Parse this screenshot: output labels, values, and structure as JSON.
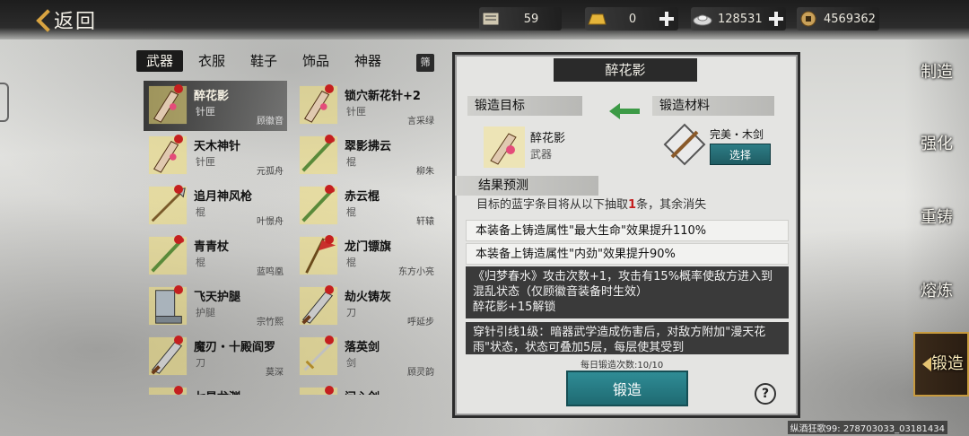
{
  "header": {
    "back_label": "返回",
    "resources": [
      {
        "icon": "ledger-icon",
        "value": "59",
        "plus": false
      },
      {
        "icon": "gold-bar-icon",
        "value": "0",
        "plus": true
      },
      {
        "icon": "silver-ingot-icon",
        "value": "128531",
        "plus": true
      },
      {
        "icon": "copper-coin-icon",
        "value": "4569362",
        "plus": false
      }
    ]
  },
  "tabs": [
    "武器",
    "衣服",
    "鞋子",
    "饰品",
    "神器"
  ],
  "active_tab": "武器",
  "filter_label": "筛",
  "items": [
    {
      "name": "醉花影",
      "type": "针匣",
      "owner": "顾徽音",
      "selected": true,
      "icon": "needle-box-icon"
    },
    {
      "name": "锁穴新花针+2",
      "type": "针匣",
      "owner": "言采绿",
      "selected": false,
      "icon": "needle-box-icon"
    },
    {
      "name": "天木神针",
      "type": "针匣",
      "owner": "元孤舟",
      "selected": false,
      "icon": "needle-box-icon"
    },
    {
      "name": "翠影拂云",
      "type": "棍",
      "owner": "柳朱",
      "selected": false,
      "icon": "staff-icon"
    },
    {
      "name": "追月神风枪",
      "type": "棍",
      "owner": "叶憬舟",
      "selected": false,
      "icon": "spear-icon"
    },
    {
      "name": "赤云棍",
      "type": "棍",
      "owner": "轩辕",
      "selected": false,
      "icon": "staff-icon"
    },
    {
      "name": "青青杖",
      "type": "棍",
      "owner": "蓝鸣凰",
      "selected": false,
      "icon": "staff-icon"
    },
    {
      "name": "龙门镖旗",
      "type": "棍",
      "owner": "东方小亮",
      "selected": false,
      "icon": "flag-icon"
    },
    {
      "name": "飞天护腿",
      "type": "护腿",
      "owner": "宗竹熙",
      "selected": false,
      "icon": "greaves-icon"
    },
    {
      "name": "劫火铸灰",
      "type": "刀",
      "owner": "呼延步",
      "selected": false,
      "icon": "blade-icon"
    },
    {
      "name": "魔刃・十殿阎罗",
      "type": "刀",
      "owner": "莫深",
      "selected": false,
      "icon": "blade-icon"
    },
    {
      "name": "落英剑",
      "type": "剑",
      "owner": "顾灵韵",
      "selected": false,
      "icon": "sword-icon"
    },
    {
      "name": "七星龙渊",
      "type": "",
      "owner": "",
      "selected": false,
      "icon": "sword-icon"
    },
    {
      "name": "问心剑",
      "type": "",
      "owner": "",
      "selected": false,
      "icon": "sword-icon"
    }
  ],
  "panel": {
    "title": "醉花影",
    "target_head": "锻造目标",
    "material_head": "锻造材料",
    "target_name": "醉花影",
    "target_type": "武器",
    "material_name": "完美・木剑",
    "select_label": "选择",
    "result_head": "结果预测",
    "result_desc_pre": "目标的蓝字条目将从以下抽取",
    "result_desc_num": "1",
    "result_desc_post": "条，其余消失",
    "lines": [
      "本装备上铸造属性\"最大生命\"效果提升110%",
      "本装备上铸造属性\"内劲\"效果提升90%"
    ],
    "special1_text": "《归梦春水》攻击次数+1，攻击有15%概率使敌方进入到混乱状态（仅顾徽音装备时生效）",
    "special1_sub": "醉花影+15解锁",
    "special2_text": "穿针引线1级：暗器武学造成伤害后，对敌方附加\"漫天花雨\"状态，状态可叠加5层，每层使其受到",
    "daily_label": "每日锻造次数:10/10",
    "forge_label": "锻造",
    "help_label": "?"
  },
  "right_nav": [
    "制造",
    "强化",
    "重铸",
    "熔炼",
    "锻造"
  ],
  "right_nav_active": "锻造",
  "watermark": "纵酒狂歌99: 278703033_03181434"
}
